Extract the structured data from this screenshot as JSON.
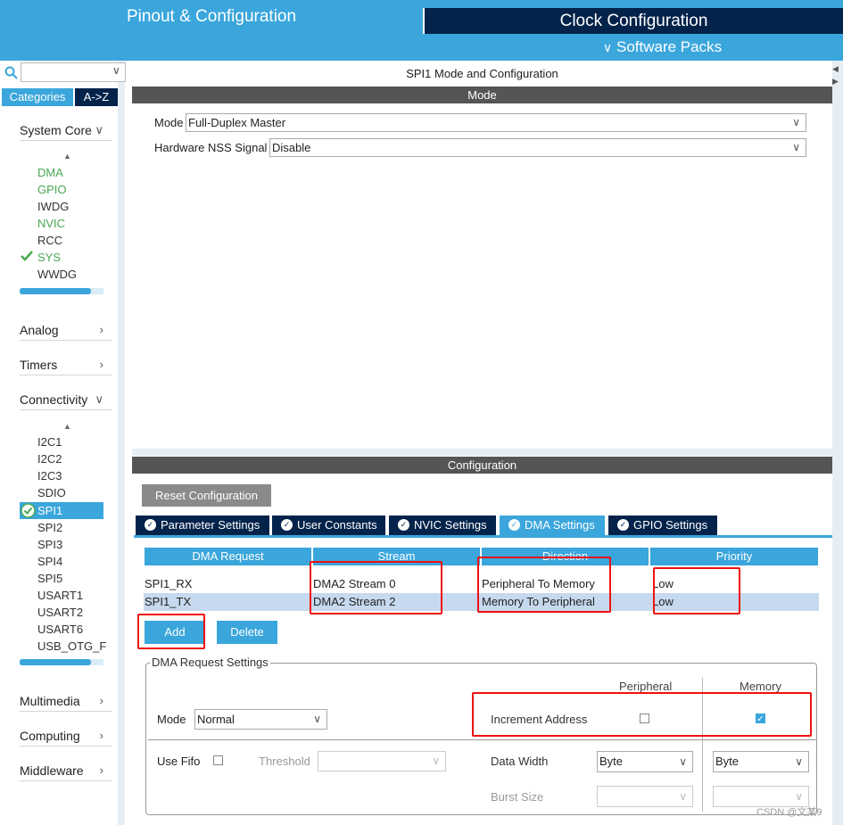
{
  "header": {
    "pinout_tab": "Pinout & Configuration",
    "clock_tab": "Clock Configuration",
    "software_packs": "Software Packs"
  },
  "sidebar": {
    "search_value": "",
    "categories_label": "Categories",
    "az_label": "A->Z",
    "system_core": {
      "label": "System Core",
      "items": [
        "DMA",
        "GPIO",
        "IWDG",
        "NVIC",
        "RCC",
        "SYS",
        "WWDG"
      ]
    },
    "analog": "Analog",
    "timers": "Timers",
    "connectivity": {
      "label": "Connectivity",
      "items": [
        "I2C1",
        "I2C2",
        "I2C3",
        "SDIO",
        "SPI1",
        "SPI2",
        "SPI3",
        "SPI4",
        "SPI5",
        "USART1",
        "USART2",
        "USART6",
        "USB_OTG_F"
      ]
    },
    "multimedia": "Multimedia",
    "computing": "Computing",
    "middleware": "Middleware"
  },
  "mode_panel": {
    "title": "SPI1 Mode and Configuration",
    "section": "Mode",
    "mode_label": "Mode",
    "mode_value": "Full-Duplex Master",
    "nss_label": "Hardware NSS Signal",
    "nss_value": "Disable"
  },
  "config_panel": {
    "section": "Configuration",
    "reset_button": "Reset Configuration",
    "tabs": [
      "Parameter Settings",
      "User Constants",
      "NVIC Settings",
      "DMA Settings",
      "GPIO Settings"
    ],
    "active_tab": "DMA Settings",
    "table": {
      "headers": [
        "DMA Request",
        "Stream",
        "Direction",
        "Priority"
      ],
      "rows": [
        [
          "SPI1_RX",
          "DMA2 Stream 0",
          "Peripheral To Memory",
          "Low"
        ],
        [
          "SPI1_TX",
          "DMA2 Stream 2",
          "Memory To Peripheral",
          "Low"
        ]
      ]
    },
    "add_button": "Add",
    "delete_button": "Delete",
    "request_settings": {
      "legend": "DMA Request Settings",
      "peripheral_header": "Peripheral",
      "memory_header": "Memory",
      "mode_label": "Mode",
      "mode_value": "Normal",
      "increment_label": "Increment Address",
      "use_fifo_label": "Use Fifo",
      "threshold_label": "Threshold",
      "data_width_label": "Data Width",
      "peripheral_width": "Byte",
      "memory_width": "Byte",
      "burst_size_label": "Burst Size"
    }
  },
  "watermark": "CSDN @文某9",
  "colors": {
    "accent": "#3aa6dc",
    "navy": "#03234b",
    "highlight": "#e11111",
    "green": "#49a853"
  }
}
